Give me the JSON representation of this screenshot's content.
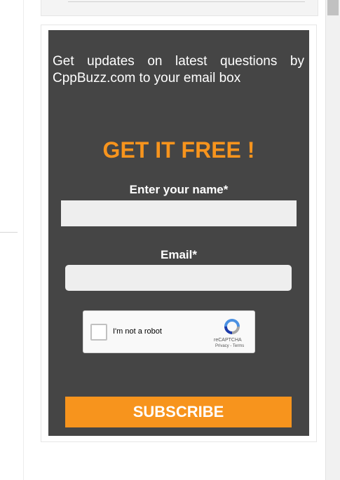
{
  "widget": {
    "intro_text": "Get updates on latest questions by CppBuzz.com to your email box",
    "headline": "GET IT FREE !",
    "name_label": "Enter your name*",
    "name_value": "",
    "email_label": "Email*",
    "email_value": "",
    "captcha_label": "I'm not a robot",
    "captcha_brand": "reCAPTCHA",
    "captcha_links": "Privacy - Terms",
    "subscribe_label": "SUBSCRIBE"
  },
  "colors": {
    "panel_bg": "#454545",
    "accent": "#f7941d",
    "input_bg": "#eeeeee",
    "text": "#ffffff"
  },
  "icons": {
    "captcha_logo": "recaptcha-icon",
    "checkbox": "checkbox-icon"
  }
}
